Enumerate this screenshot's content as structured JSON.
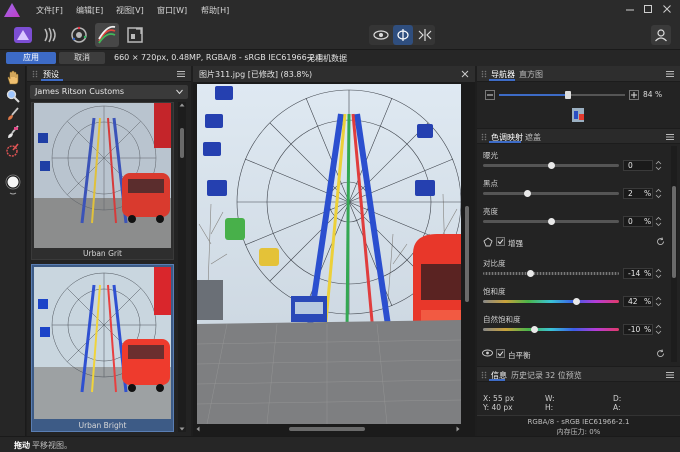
{
  "menu": {
    "items": [
      "文件[F]",
      "编辑[E]",
      "视图[V]",
      "窗口[W]",
      "帮助[H]"
    ],
    "window_controls": [
      "minimize-icon",
      "maximize-icon",
      "close-icon"
    ]
  },
  "toolbar": {
    "personas": [
      "photo-persona-icon",
      "liquify-persona-icon",
      "develop-persona-icon",
      "tone-mapping-persona-icon",
      "export-persona-icon"
    ],
    "active_persona": "tone-mapping-persona-icon",
    "view_modes": [
      "view-icon",
      "split-view-icon",
      "mirror-view-icon"
    ]
  },
  "context": {
    "apply_label": "应用",
    "cancel_label": "取消",
    "doc_info": "660 × 720px, 0.48MP, RGBA/8 - sRGB IEC61966-2.1",
    "metadata": "无相机数据"
  },
  "left_panel": {
    "tab_label": "预设",
    "dropdown_value": "James Ritson Customs",
    "presets": [
      {
        "name": "Urban Grit",
        "selected": false
      },
      {
        "name": "Urban Bright",
        "selected": true
      }
    ]
  },
  "document": {
    "tab_title": "图片311.jpg [已修改] (83.8%)"
  },
  "navigator": {
    "tabs": [
      "导航器",
      "直方图"
    ],
    "active_tab": "导航器",
    "zoom_value": "84",
    "zoom_unit": "%",
    "zoom_fraction": 0.55
  },
  "tone": {
    "tabs": [
      "色调映射",
      "遮盖"
    ],
    "active_tab": "色调映射",
    "sliders": [
      {
        "label": "曝光",
        "value": "0",
        "unit": "",
        "pos": 0.5
      },
      {
        "label": "黑点",
        "value": "2",
        "unit": "%",
        "pos": 0.33
      },
      {
        "label": "亮度",
        "value": "0",
        "unit": "%",
        "pos": 0.5
      }
    ],
    "enhance_label": "增强",
    "color_sliders": [
      {
        "label": "对比度",
        "value": "-14",
        "unit": "%",
        "pos": 0.35
      },
      {
        "label": "饱和度",
        "value": "42",
        "unit": "%",
        "pos": 0.69
      },
      {
        "label": "自然饱和度",
        "value": "-10",
        "unit": "%",
        "pos": 0.38
      }
    ],
    "white_balance_label": "白平衡"
  },
  "info_panel": {
    "tabs": [
      "信息",
      "历史记录",
      "32 位预览"
    ],
    "active_tab": "信息",
    "x_label": "X: 55 px",
    "y_label": "Y: 40 px",
    "w_label": "W:",
    "h_label": "H:",
    "d_label": "D:",
    "a_label": "A:",
    "color_profile": "RGBA/8 - sRGB IEC61966-2.1",
    "memory": "内存压力: 0%"
  },
  "status": {
    "tool_name": "拖动",
    "hint": "平移视图。"
  },
  "colors": {
    "accent": "#3d6bc6",
    "background": "#1e1e1e"
  }
}
